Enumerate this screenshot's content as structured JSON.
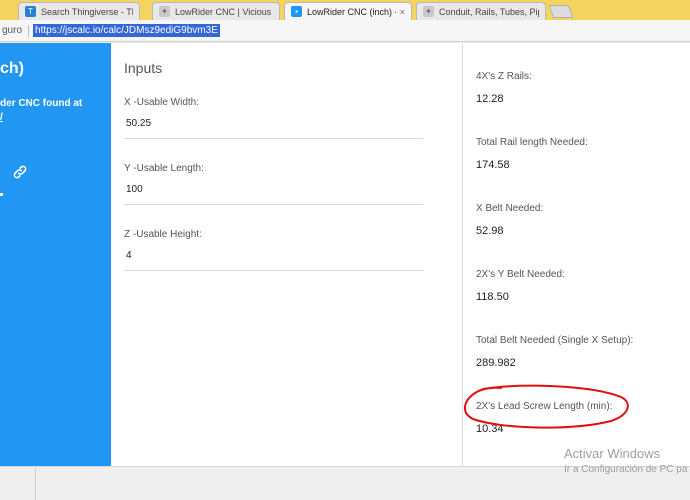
{
  "browser": {
    "tabs": [
      {
        "label": "Search Thingiverse - Thi",
        "fade": "...",
        "icon": "thingiverse-icon"
      },
      {
        "label": "LowRider CNC | Vicious C",
        "fade": "...",
        "icon": "puzzle-icon"
      },
      {
        "label": "LowRider CNC (inch) - JS",
        "fade": "...",
        "icon": "jscalc-icon"
      },
      {
        "label": "Conduit, Rails, Tubes, Pip",
        "fade": "...",
        "icon": "puzzle-icon"
      }
    ],
    "close_glyph": "×",
    "secure_label": "guro",
    "url": "https://jscalc.io/calc/JDMsz9ediG9bvm3E"
  },
  "sidebar": {
    "title": "ch)",
    "desc_line1": "der CNC found at",
    "desc_line2": "/"
  },
  "inputs": {
    "title": "Inputs",
    "fields": [
      {
        "label": "X -Usable Width:",
        "value": "50.25"
      },
      {
        "label": "Y -Usable Length:",
        "value": "100"
      },
      {
        "label": "Z -Usable Height:",
        "value": "4"
      }
    ]
  },
  "outputs": [
    {
      "label": "4X's Z Rails:",
      "value": "12.28"
    },
    {
      "label": "Total Rail length Needed:",
      "value": "174.58"
    },
    {
      "label": "X Belt Needed:",
      "value": "52.98"
    },
    {
      "label": "2X's Y Belt Needed:",
      "value": "118.50"
    },
    {
      "label": "Total Belt Needed (Single X Setup):",
      "value": "289.982"
    },
    {
      "label": "2X's Lead Screw Length (min):",
      "value": "10.34"
    }
  ],
  "watermark": {
    "line1": "Activar Windows",
    "line2": "Ir a Configuración de PC pa"
  },
  "colors": {
    "sidebar": "#2196f3",
    "tabbar": "#f4d35e",
    "annotation": "#e01010"
  }
}
